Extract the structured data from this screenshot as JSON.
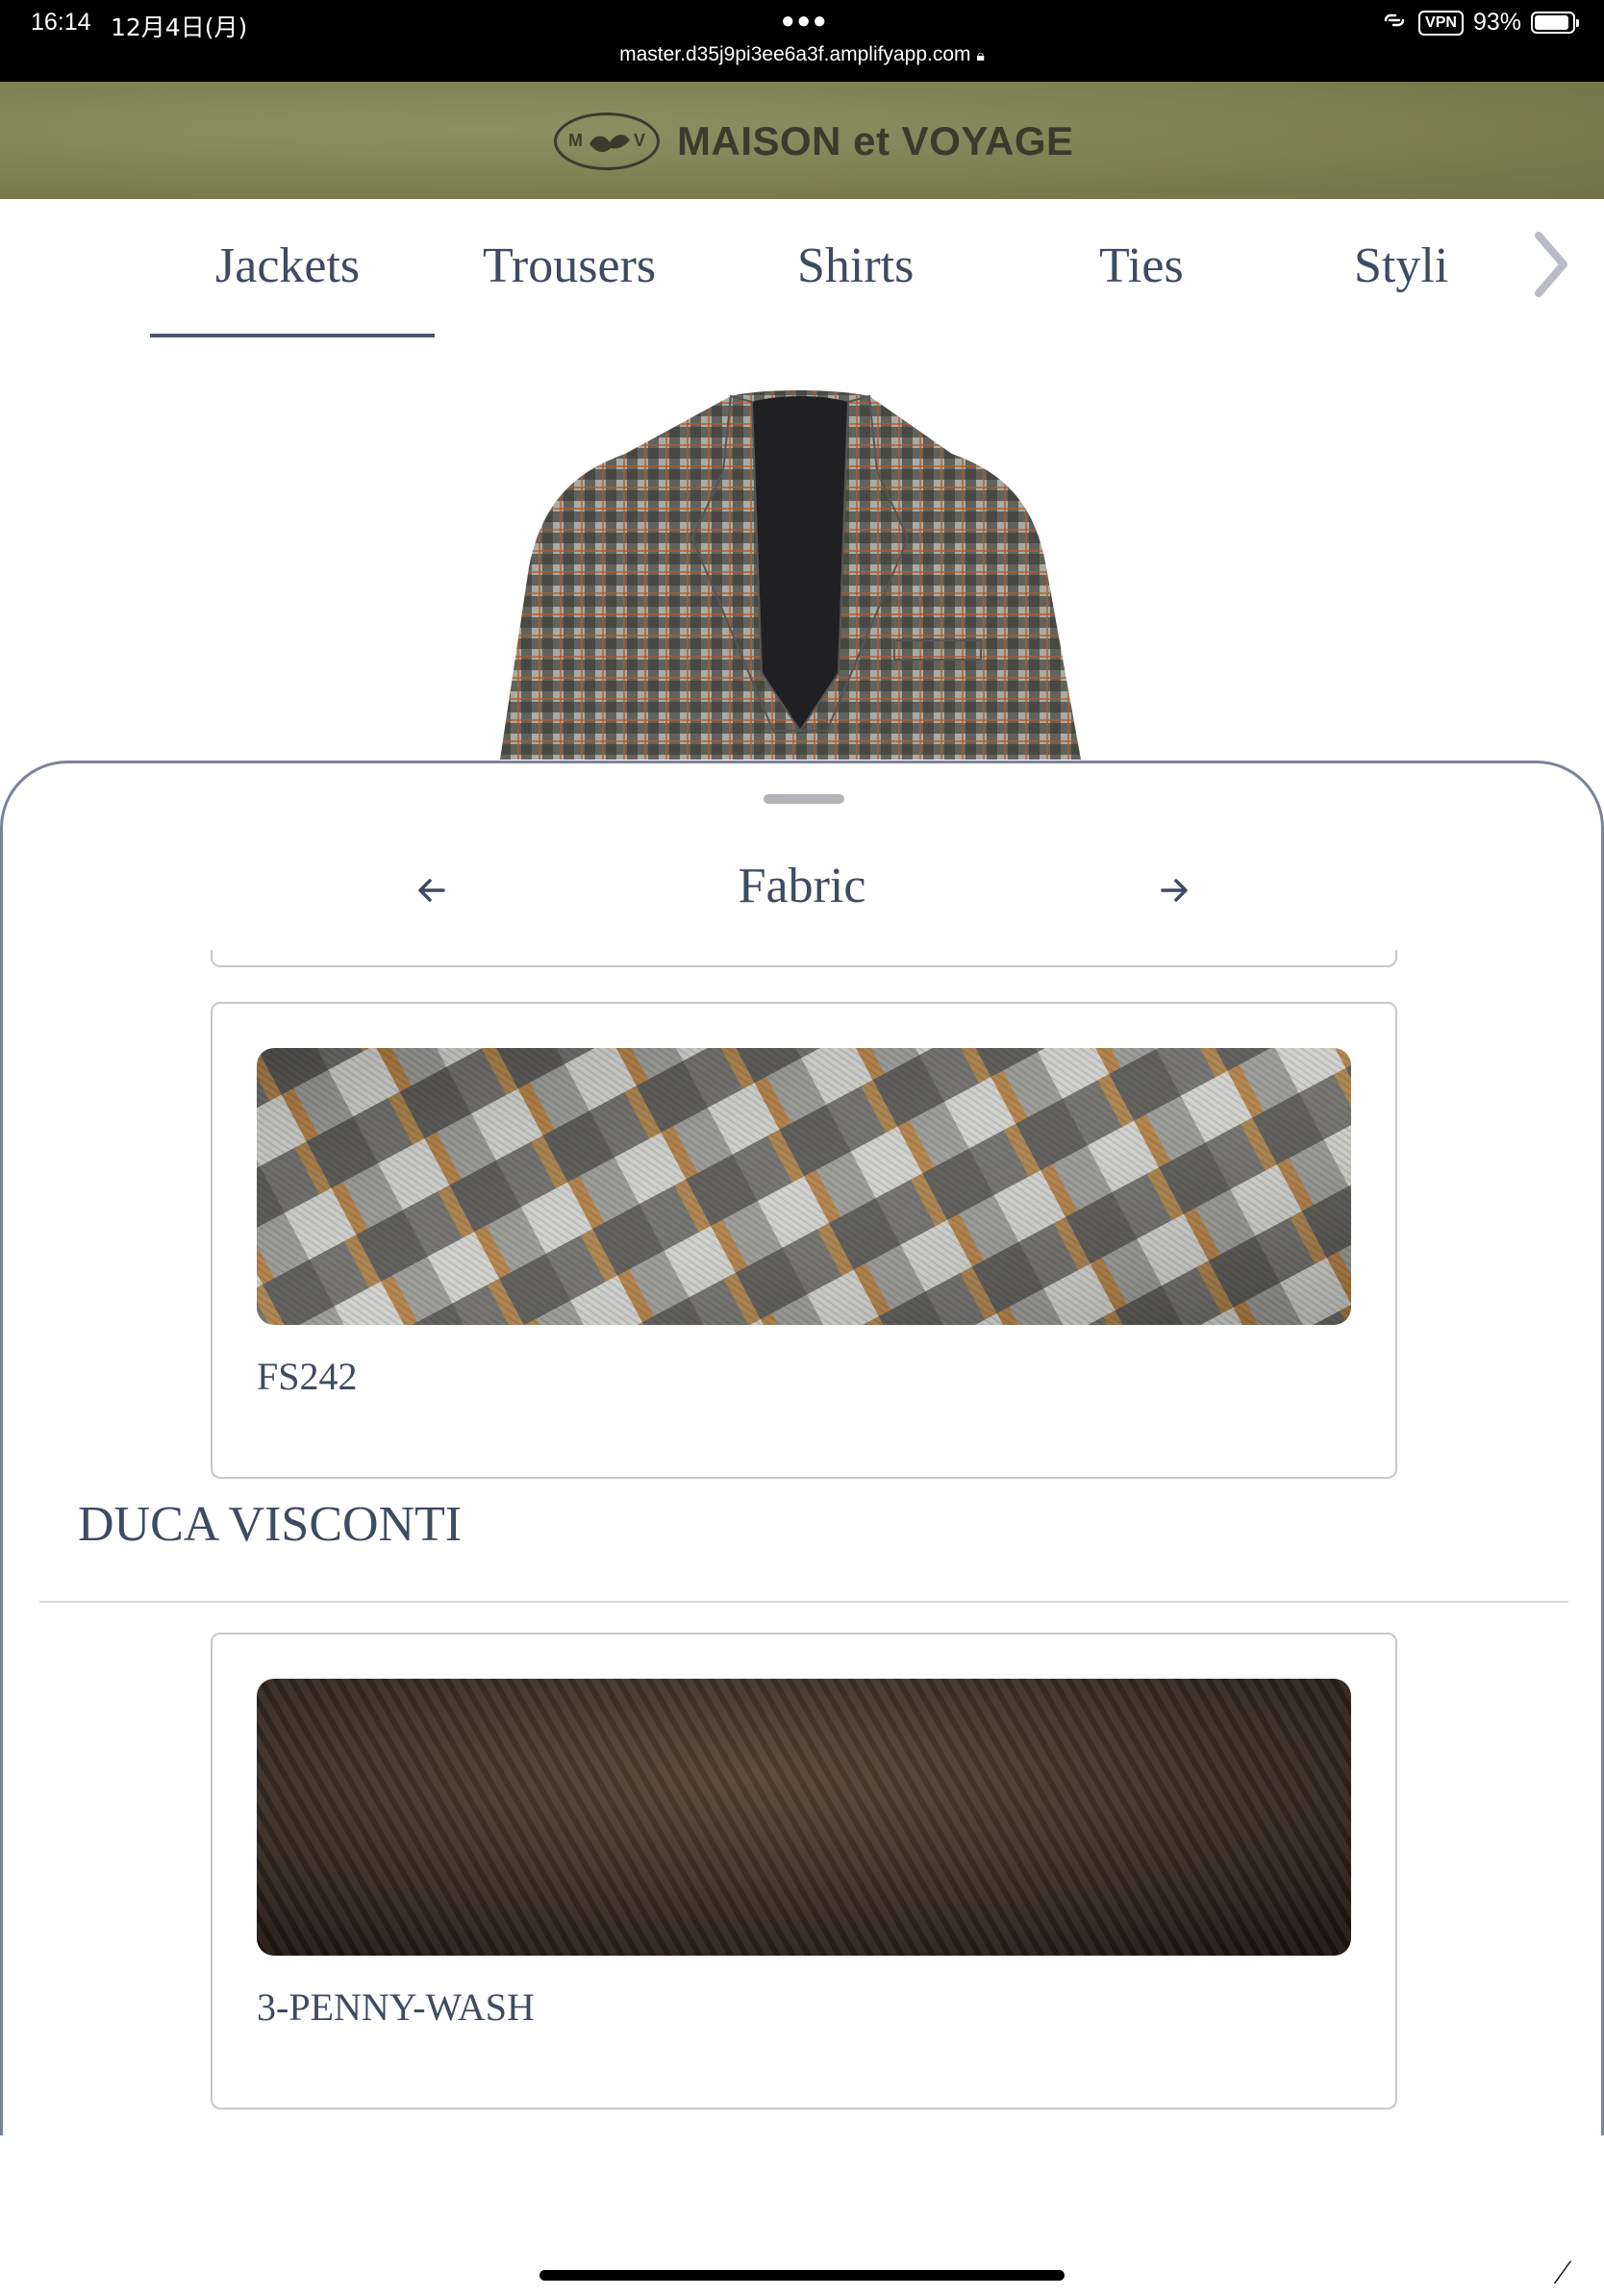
{
  "status_bar": {
    "time": "16:14",
    "date": "12月4日(月)",
    "url": "master.d35j9pi3ee6a3f.amplifyapp.com",
    "vpn": "VPN",
    "battery": "93%",
    "battery_level": 0.93
  },
  "header": {
    "brand_name": "MAISON et VOYAGE",
    "logo_letters": [
      "M",
      "V"
    ]
  },
  "tabs": {
    "items": [
      "Jackets",
      "Trousers",
      "Shirts",
      "Ties",
      "Styli"
    ],
    "selected": "Jackets"
  },
  "sheet": {
    "title": "Fabric",
    "cards": [
      {
        "code": "FS242",
        "pattern": "gingham-check-orange-black-grey"
      },
      {
        "code": "3-PENNY-WASH",
        "pattern": "brown-corduroy"
      }
    ],
    "section_title": "DUCA VISCONTI"
  },
  "colors": {
    "accent_text": "#3f4a63",
    "header_bg": "#7d8052",
    "card_border": "#c8c8cc"
  }
}
